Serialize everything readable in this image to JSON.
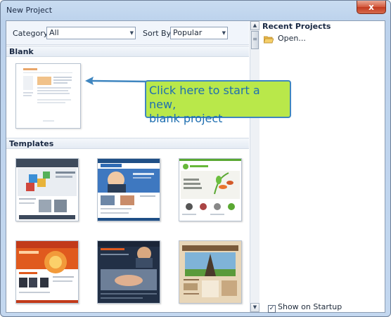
{
  "window": {
    "title": "New Project",
    "close_label": "x"
  },
  "filters": {
    "category_label": "Category:",
    "category_value": "All",
    "sortby_label": "Sort By:",
    "sortby_value": "Popular"
  },
  "sections": {
    "blank": "Blank",
    "templates": "Templates"
  },
  "recent": {
    "header": "Recent Projects",
    "open_label": "Open..."
  },
  "show_on_startup": {
    "label": "Show on Startup",
    "checked": true
  },
  "callout": {
    "line1": "Click here to start a new,",
    "line2": "blank project"
  },
  "template_thumbs": [
    {
      "name": "template-it-solutions",
      "title": "IT SOLUTIONS"
    },
    {
      "name": "template-business-woman"
    },
    {
      "name": "template-greenglow",
      "title": "GREENGLOW",
      "text": "FRESH ACTUAL IMPRESSIVE"
    },
    {
      "name": "template-orange-team",
      "text": "OUR TEAM"
    },
    {
      "name": "template-handshake"
    },
    {
      "name": "template-eiffel-tower"
    }
  ],
  "colors": {
    "accent": "#3f86c0",
    "callout_bg": "#b9e84a",
    "frame": "#c3d7ef"
  }
}
